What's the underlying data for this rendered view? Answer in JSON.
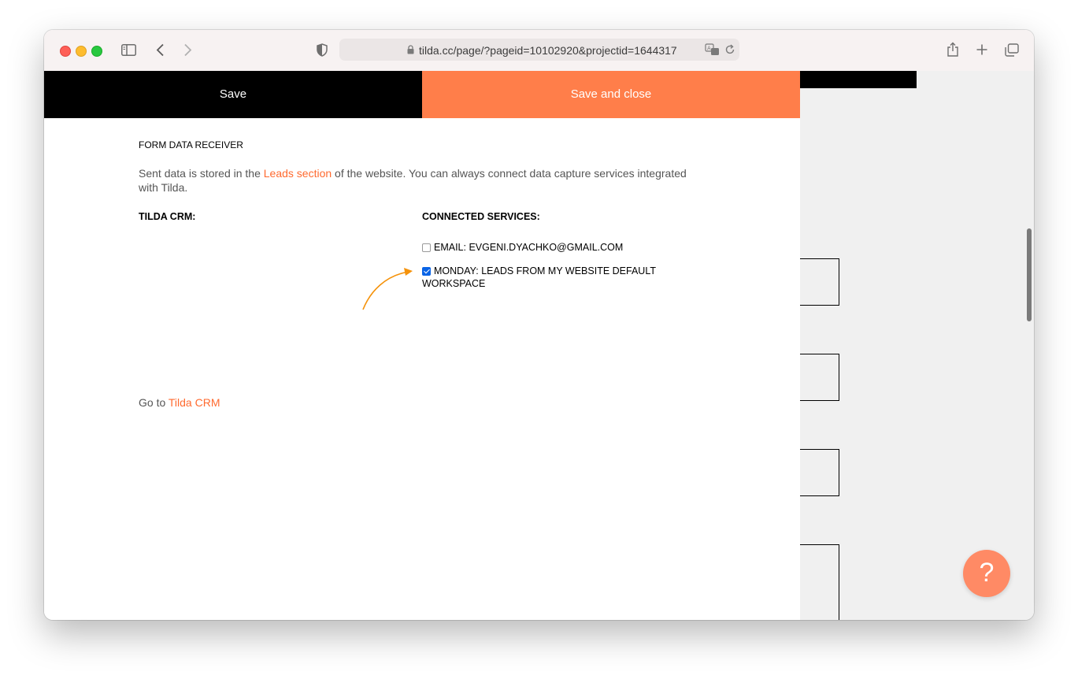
{
  "browser": {
    "url": "tilda.cc/page/?pageid=10102920&projectid=1644317"
  },
  "actions": {
    "save": "Save",
    "save_close": "Save and close"
  },
  "form": {
    "section_title": "FORM DATA RECEIVER",
    "desc_before": "Sent data is stored in the ",
    "desc_link": "Leads section",
    "desc_after": " of the website. You can always connect data capture services integrated with Tilda.",
    "tilda_crm_title": "TILDA CRM:",
    "connected_title": "CONNECTED SERVICES:",
    "services": [
      {
        "label": "EMAIL: EVGENI.DYACHKO@GMAIL.COM",
        "checked": false
      },
      {
        "label": "MONDAY: LEADS FROM MY WEBSITE DEFAULT WORKSPACE",
        "checked": true
      }
    ],
    "goto_prefix": "Go to ",
    "goto_link": "Tilda CRM"
  },
  "help": {
    "symbol": "?"
  },
  "colors": {
    "accent": "#ff7e4a",
    "link": "#ff6a2f",
    "annotation_arrow": "#f5920a",
    "checkbox": "#0a64e6"
  },
  "icons": [
    "sidebar-icon",
    "back-icon",
    "forward-icon",
    "shield-icon",
    "lock-icon",
    "translate-icon",
    "reload-icon",
    "share-icon",
    "new-tab-icon",
    "tabs-overview-icon",
    "help-icon"
  ]
}
